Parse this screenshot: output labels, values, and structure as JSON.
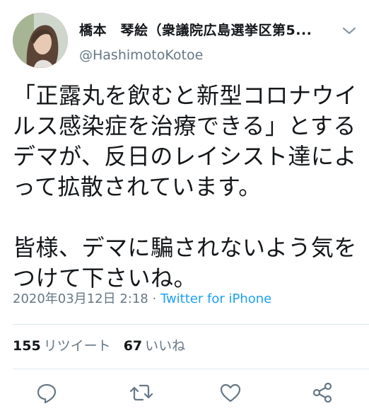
{
  "author": {
    "display_name": "橋本　琴絵（衆議院広島選挙区第5...",
    "handle": "@HashimotoKotoe"
  },
  "tweet": {
    "lines": [
      "「正露丸を飲むと新型コロナウイ",
      "ルス感染症を治療できる」とする",
      "デマが、反日のレイシスト達によ",
      "って拡散されています。",
      "皆様、デマに騙されないよう気を",
      "つけて下さいね。"
    ],
    "timestamp": "2020年03月12日 2:18",
    "separator": " · ",
    "source": "Twitter for iPhone"
  },
  "stats": {
    "retweets_count": "155",
    "retweets_label": "リツイート",
    "likes_count": "67",
    "likes_label": "いいね"
  },
  "icons": {
    "caret": "chevron-down-icon",
    "reply": "reply-icon",
    "retweet": "retweet-icon",
    "like": "like-heart-icon",
    "share": "share-icon"
  },
  "colors": {
    "text": "#14171a",
    "muted": "#657786",
    "link": "#1da1f2",
    "divider": "#e1e8ed"
  }
}
